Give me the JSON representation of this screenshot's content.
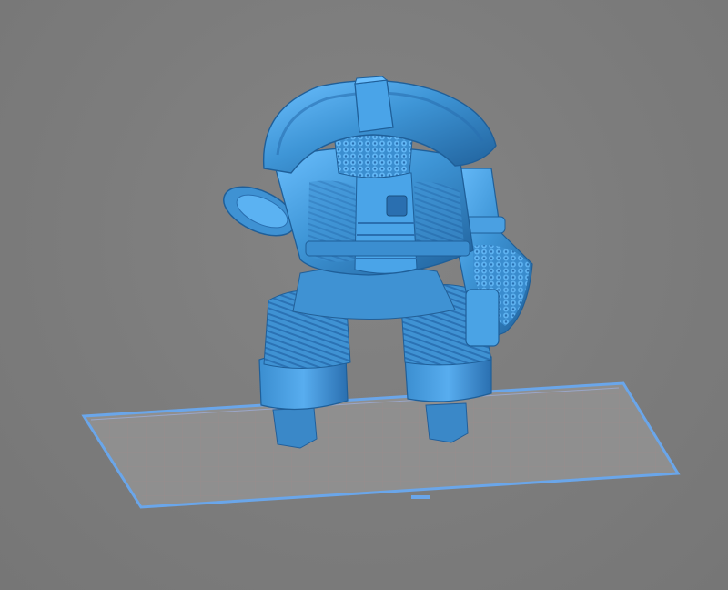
{
  "viewport": {
    "background": "#7e7e7e",
    "build_plate": {
      "fill": "#8f8f8f",
      "border_color": "#6aa6ea",
      "grid_color": "#9e8a8a",
      "grid_columns": 30,
      "grid_rows": 10
    },
    "model": {
      "color": "#3e95d6",
      "highlight": "#6cc0ff",
      "shadow": "#1f5f99",
      "parts": [
        "hat-brim",
        "head-stub",
        "chain-mail-collar",
        "jacket",
        "pants",
        "left-arm",
        "right-arm",
        "left-leg",
        "right-leg"
      ]
    }
  }
}
